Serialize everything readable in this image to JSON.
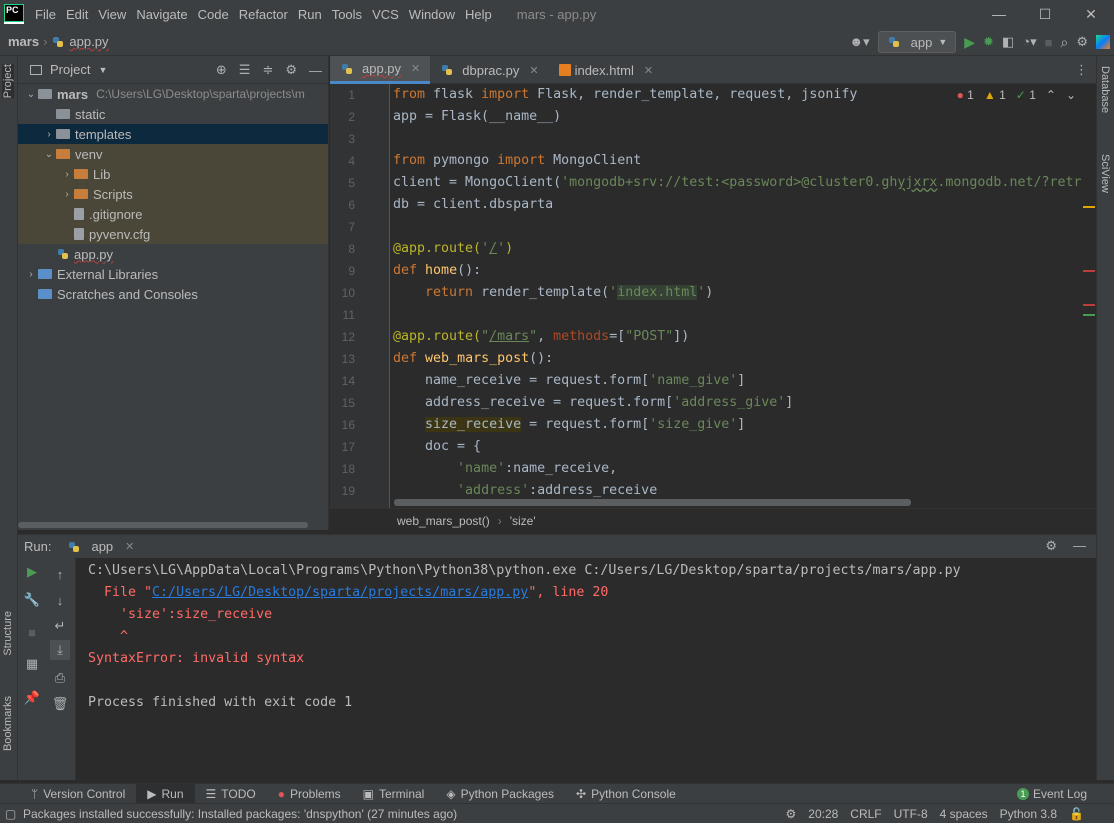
{
  "title_bar": {
    "logo": "PC",
    "menu": [
      "File",
      "Edit",
      "View",
      "Navigate",
      "Code",
      "Refactor",
      "Run",
      "Tools",
      "VCS",
      "Window",
      "Help"
    ],
    "window_title": "mars - app.py",
    "controls": {
      "minimize": "—",
      "maximize": "☐",
      "close": "✕"
    }
  },
  "nav": {
    "project": "mars",
    "file": "app.py",
    "run_config": "app",
    "icons": [
      "user-icon",
      "run-icon",
      "debug-icon",
      "coverage-icon",
      "profile-icon",
      "stop-icon",
      "search-icon",
      "settings-icon",
      "jetbrains-icon"
    ]
  },
  "left_strip": {
    "project": "Project",
    "structure": "Structure",
    "bookmarks": "Bookmarks"
  },
  "right_strip": {
    "database": "Database",
    "sciview": "SciView"
  },
  "project_panel": {
    "title": "Project",
    "items": [
      {
        "label": "mars",
        "path": "C:\\Users\\LG\\Desktop\\sparta\\projects\\m",
        "level": 0,
        "arrow": "⌄",
        "type": "folder"
      },
      {
        "label": "static",
        "level": 1,
        "arrow": "",
        "type": "folder"
      },
      {
        "label": "templates",
        "level": 1,
        "arrow": "›",
        "type": "folder"
      },
      {
        "label": "venv",
        "level": 1,
        "arrow": "⌄",
        "type": "folder-orange"
      },
      {
        "label": "Lib",
        "level": 2,
        "arrow": "›",
        "type": "folder-orange"
      },
      {
        "label": "Scripts",
        "level": 2,
        "arrow": "›",
        "type": "folder-orange"
      },
      {
        "label": ".gitignore",
        "level": 2,
        "arrow": "",
        "type": "file"
      },
      {
        "label": "pyvenv.cfg",
        "level": 2,
        "arrow": "",
        "type": "file"
      },
      {
        "label": "app.py",
        "level": 1,
        "arrow": "",
        "type": "py"
      },
      {
        "label": "External Libraries",
        "level": 0,
        "arrow": "›",
        "type": "lib"
      },
      {
        "label": "Scratches and Consoles",
        "level": 0,
        "arrow": "",
        "type": "scratch"
      }
    ]
  },
  "editor": {
    "tabs": [
      {
        "label": "app.py",
        "active": true
      },
      {
        "label": "dbprac.py",
        "active": false
      },
      {
        "label": "index.html",
        "active": false
      }
    ],
    "inspections": {
      "errors": "1",
      "warnings": "1",
      "ok": "1"
    },
    "line_numbers": [
      "1",
      "2",
      "3",
      "4",
      "5",
      "6",
      "7",
      "8",
      "9",
      "10",
      "11",
      "12",
      "13",
      "14",
      "15",
      "16",
      "17",
      "18",
      "19"
    ],
    "breadcrumb": [
      "web_mars_post()",
      "'size'"
    ]
  },
  "run": {
    "label": "Run:",
    "tab": "app",
    "console": [
      "C:\\Users\\LG\\AppData\\Local\\Programs\\Python\\Python38\\python.exe C:/Users/LG/Desktop/sparta/projects/mars/app.py",
      "  File \"",
      "C:/Users/LG/Desktop/sparta/projects/mars/app.py",
      "\", line 20",
      "    'size':size_receive",
      "    ^",
      "SyntaxError: invalid syntax",
      "",
      "Process finished with exit code 1"
    ]
  },
  "tool_tabs": [
    "Version Control",
    "Run",
    "TODO",
    "Problems",
    "Terminal",
    "Python Packages",
    "Python Console"
  ],
  "event_log": {
    "count": "1",
    "label": "Event Log"
  },
  "status": {
    "message": "Packages installed successfully: Installed packages: 'dnspython' (27 minutes ago)",
    "position": "20:28",
    "line_sep": "CRLF",
    "encoding": "UTF-8",
    "indent": "4 spaces",
    "interpreter": "Python 3.8"
  },
  "colors": {
    "accent": "#4a88c7",
    "error": "#ff6b68",
    "link": "#287bde",
    "keyword": "#cc7832",
    "string": "#6a8759"
  }
}
